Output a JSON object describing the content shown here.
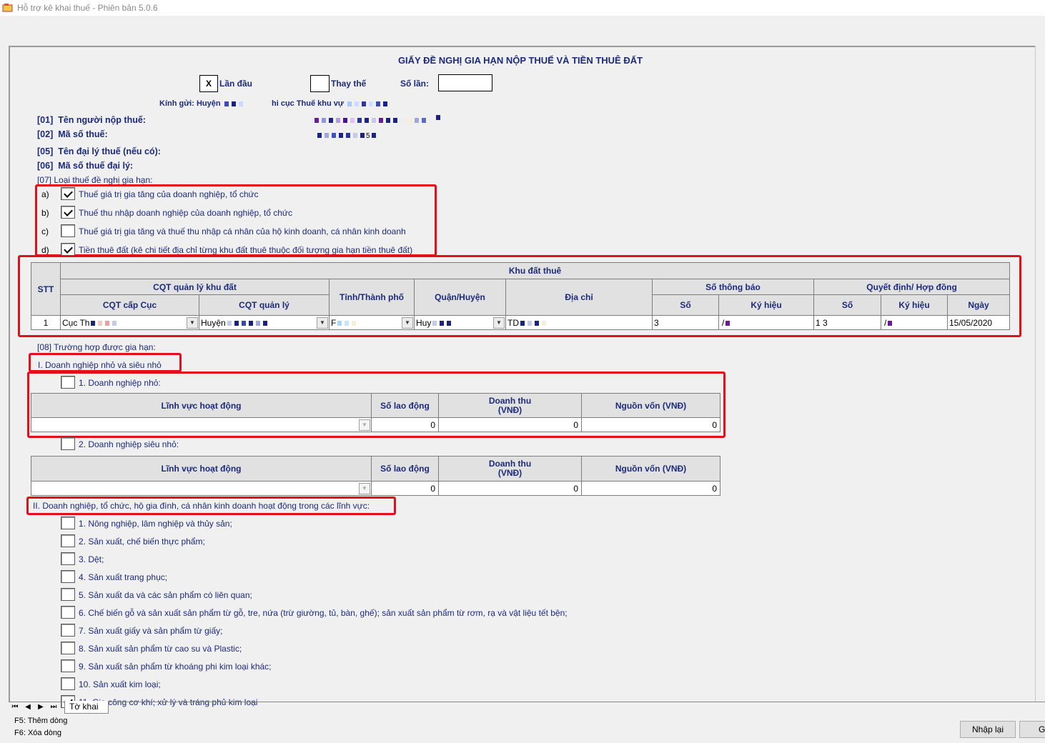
{
  "window": {
    "title": "Hỗ trợ kê khai thuế -  Phiên bản 5.0.6"
  },
  "form": {
    "title": "GIẤY ĐỀ NGHỊ GIA HẠN NỘP THUẾ VÀ TIỀN THUÊ ĐẤT",
    "first_time": {
      "mark": "X",
      "label": "Lần đầu"
    },
    "replace": {
      "label": "Thay thế"
    },
    "times_label": "Số lần:",
    "times_value": "",
    "recipient_prefix": "Kính gửi:  Huyện",
    "recipient_middle": "hi cục Thuế khu vự",
    "fields": [
      {
        "code": "[01]",
        "label": "Tên người nộp thuế:"
      },
      {
        "code": "[02]",
        "label": "Mã số thuế:"
      },
      {
        "code": "[05]",
        "label": "Tên đại lý thuế (nếu có):"
      },
      {
        "code": "[06]",
        "label": "Mã số thuế đại lý:"
      }
    ],
    "tax_code_tail": "5",
    "section07": "[07]   Loại thuế đề nghị gia hạn:",
    "tax_types": [
      {
        "letter": "a)",
        "label": "Thuế giá trị gia tăng của doanh nghiệp, tổ chức",
        "checked": true
      },
      {
        "letter": "b)",
        "label": "Thuế thu nhập doanh nghiệp của doanh nghiệp, tổ chức",
        "checked": true
      },
      {
        "letter": "c)",
        "label": "Thuế giá trị gia tăng và thuế thu nhập cá nhân của hộ kinh doanh, cá nhân kinh doanh",
        "checked": false
      },
      {
        "letter": "d)",
        "label": "Tiền thuê đất (kê chi tiết địa chỉ từng khu đất thuê thuộc đối tượng gia hạn tiền thuê đất)",
        "checked": true
      }
    ],
    "land_table": {
      "stt": "STT",
      "group": "Khu đất thuê",
      "cqt": "CQT quản lý khu đất",
      "cqt_cap_cuc": "CQT cấp Cục",
      "cqt_quan_ly": "CQT quản lý",
      "tinh": "Tỉnh/Thành phố",
      "quan": "Quận/Huyện",
      "dia_chi": "Địa chỉ",
      "so_thong_bao": "Số thông báo",
      "quyet_dinh": "Quyết định/ Hợp đồng",
      "so": "Số",
      "ky_hieu": "Ký hiệu",
      "so2": "Số",
      "ky_hieu2": "Ký hiệu",
      "ngay": "Ngày",
      "row": {
        "stt": "1",
        "cqt_cap_cuc": "Cục Th",
        "cqt_quan_ly": "Huyện",
        "tinh": "F",
        "quan": "Huy",
        "dia_chi": "TD",
        "so_tb": "3",
        "ky_hieu_tb": "/",
        "so_qd": "1 3",
        "ky_hieu_qd": "/",
        "ngay": "15/05/2020"
      }
    },
    "section08": "[08]   Trường hợp được gia hạn:",
    "group1_title": "I. Doanh nghiệp nhỏ và siêu nhỏ",
    "small": {
      "label": "1. Doanh nghiệp nhỏ:",
      "col1": "Lĩnh vực hoạt động",
      "col2": "Số lao động",
      "col3": "Doanh thu\n(VNĐ)",
      "col4": "Nguồn vốn (VNĐ)",
      "labor": "0",
      "revenue": "0",
      "capital": "0"
    },
    "micro": {
      "label": "2. Doanh nghiệp siêu nhỏ:",
      "col1": "Lĩnh vực hoạt động",
      "col2": "Số lao động",
      "col3": "Doanh thu\n(VNĐ)",
      "col4": "Nguồn vốn (VNĐ)",
      "labor": "0",
      "revenue": "0",
      "capital": "0"
    },
    "group2_title": "II. Doanh nghiệp, tổ chức, hộ gia đình, cá nhân kinh doanh hoạt động trong các lĩnh vực:",
    "sectors": [
      "1. Nông nghiệp, lâm nghiệp và thủy sản;",
      "2. Sản xuất, chế biến thực phẩm;",
      "3. Dệt;",
      "4. Sản xuất trang phục;",
      "5. Sản xuất da và các sản phẩm có liên quan;",
      "6. Chế biến gỗ và sản xuất sản phẩm từ gỗ, tre, nứa (trừ giường, tủ, bàn, ghế); sản xuất sản phẩm từ rơm, rạ và vật liệu tết bện;",
      "7. Sản xuất giấy và sản phẩm từ giấy;",
      "8. Sản xuất sản phẩm từ cao su và Plastic;",
      "9. Sản xuất sản phẩm từ khoáng phi kim loại khác;",
      "10. Sản xuất kim loại;",
      "11. Gia công cơ khí; xử lý và tráng phủ kim loại"
    ]
  },
  "sheet_tab": "Tờ khai",
  "shortcuts": [
    "F5: Thêm dòng",
    "F6: Xóa dòng"
  ],
  "buttons": {
    "reset": "Nhập lại",
    "next": "G"
  },
  "colors": {
    "highlight": "#e3101a",
    "label_navy": "#1c2a7a"
  }
}
